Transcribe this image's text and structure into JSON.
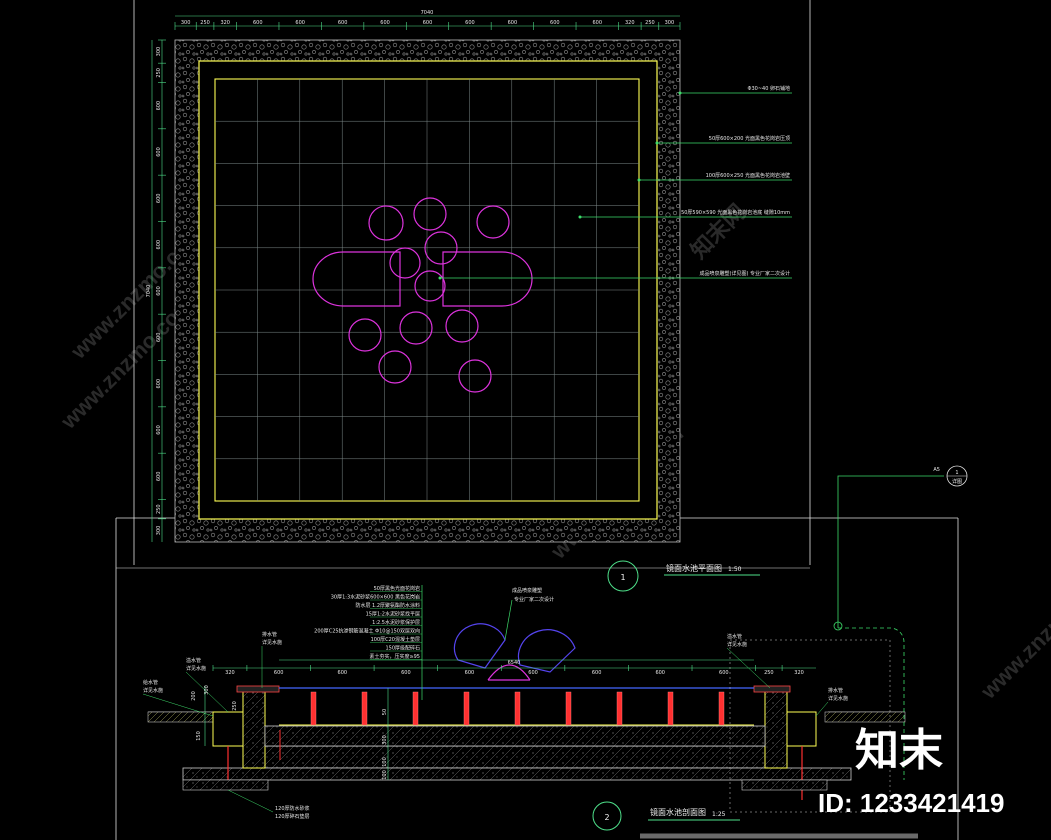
{
  "colors": {
    "background": "#000000",
    "frame": "#e0e0e0",
    "pool_outline": "#ffff55",
    "grid": "#7e8a8a",
    "feature": "#dd33dd",
    "dimension": "#4ee08a",
    "leader": "#3ddc6a",
    "steel": "#ff3030",
    "gravel": "#9a9a9a",
    "water_line": "#4466ff",
    "feature_blue": "#5544ee"
  },
  "plan": {
    "overall_dim": "7040",
    "top_dims": [
      "300",
      "250",
      "320",
      "600",
      "600",
      "600",
      "600",
      "600",
      "600",
      "600",
      "600",
      "600",
      "320",
      "250",
      "300"
    ],
    "left_dims": [
      "300",
      "250",
      "600",
      "600",
      "600",
      "600",
      "7040",
      "600",
      "600",
      "600",
      "600",
      "600",
      "250",
      "300"
    ],
    "notes": [
      "Φ30~40 卵石铺地",
      "50厚600×200 光面黑色花岗岩压顶",
      "100厚600×250 光面黑色花岗岩池壁",
      "50厚590×590 光面黑色花岗岩池底 缝隙10mm",
      "成品喷泉雕塑(详见图) 专业厂家二次设计"
    ],
    "index_num": "1",
    "title": "镜面水池平面图",
    "scale": "1:50"
  },
  "section": {
    "overall_dim": "6540",
    "top_dims": [
      "320",
      "600",
      "600",
      "600",
      "600",
      "600",
      "600",
      "600",
      "600",
      "250",
      "320"
    ],
    "layers": [
      "50厚黑色光面花岗岩",
      "30厚1:3水泥砂浆600×600 黑色花岗岩",
      "防水层 1.2厚聚氨酯防水涂料",
      "15厚1:2水泥砂浆找平层",
      "1:2.5水泥砂浆保护层",
      "200厚C25抗渗钢筋混凝土 Φ10@150双层双向",
      "100厚C20混凝土垫层",
      "150厚级配碎石",
      "素土夯实，压实度≥95"
    ],
    "sculpture_note": [
      "成品喷泉雕塑",
      "专业厂家二次设计"
    ],
    "left_labels": [
      "溢水管",
      "详见水施",
      "给水管",
      "详见水施",
      "排水管",
      "详见水施",
      "120厚防水砂浆",
      "120厚碎石垫层"
    ],
    "right_labels": [
      "溢水管",
      "详见水施",
      "排水管",
      "详见水施"
    ],
    "side_dims": [
      "200",
      "150",
      "300",
      "250",
      "50",
      "300",
      "100",
      "100"
    ],
    "index_num": "2",
    "title": "镜面水池剖面图",
    "scale": "1:25"
  },
  "callout": {
    "label": "A5",
    "num": "1",
    "sheet": "详图"
  },
  "watermarks": [
    "www.znzmo.com",
    "知末网"
  ],
  "brand": {
    "name": "知末",
    "id_label": "ID: 1233421419"
  }
}
